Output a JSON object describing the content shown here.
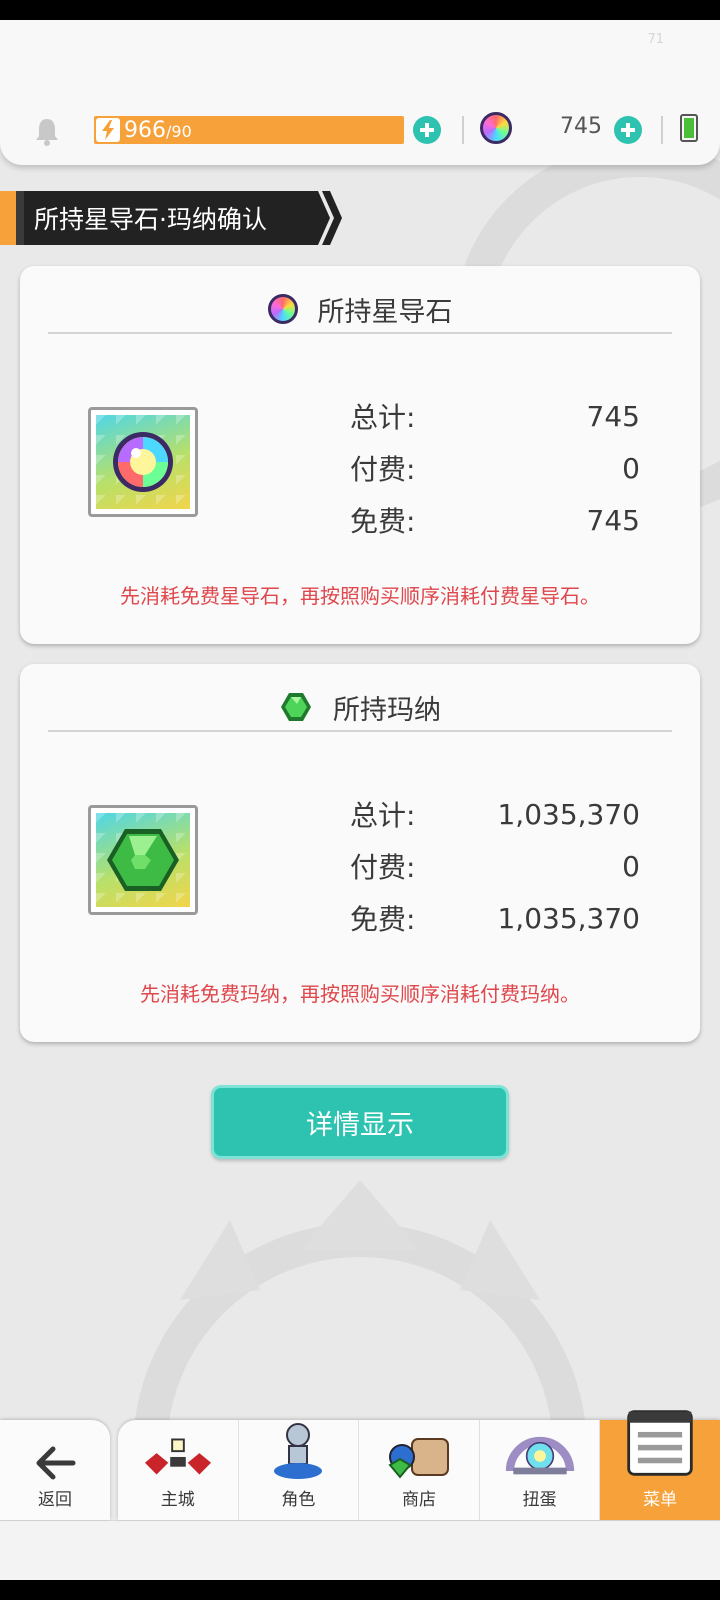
{
  "header": {
    "fps": "71",
    "stamina_current": "966",
    "stamina_max": "/90",
    "star_stone_count": "745"
  },
  "page_title": "所持星导石·玛纳确认",
  "star_stone_card": {
    "title": "所持星导石",
    "rows": [
      {
        "label": "总计:",
        "value": "745"
      },
      {
        "label": "付费:",
        "value": "0"
      },
      {
        "label": "免费:",
        "value": "745"
      }
    ],
    "note": "先消耗免费星导石，再按照购买顺序消耗付费星导石。"
  },
  "mana_card": {
    "title": "所持玛纳",
    "rows": [
      {
        "label": "总计:",
        "value": "1,035,370"
      },
      {
        "label": "付费:",
        "value": "0"
      },
      {
        "label": "免费:",
        "value": "1,035,370"
      }
    ],
    "note": "先消耗免费玛纳，再按照购买顺序消耗付费玛纳。"
  },
  "detail_button": "详情显示",
  "nav": {
    "back": "返回",
    "tabs": [
      {
        "label": "主城",
        "icon": "town-icon"
      },
      {
        "label": "角色",
        "icon": "character-icon"
      },
      {
        "label": "商店",
        "icon": "shop-icon"
      },
      {
        "label": "扭蛋",
        "icon": "gacha-icon"
      },
      {
        "label": "菜单",
        "icon": "menu-icon"
      }
    ],
    "active_tab": "菜单"
  },
  "colors": {
    "accent_orange": "#f6a13a",
    "accent_teal": "#2ec3b0",
    "note_red": "#e0474c"
  }
}
